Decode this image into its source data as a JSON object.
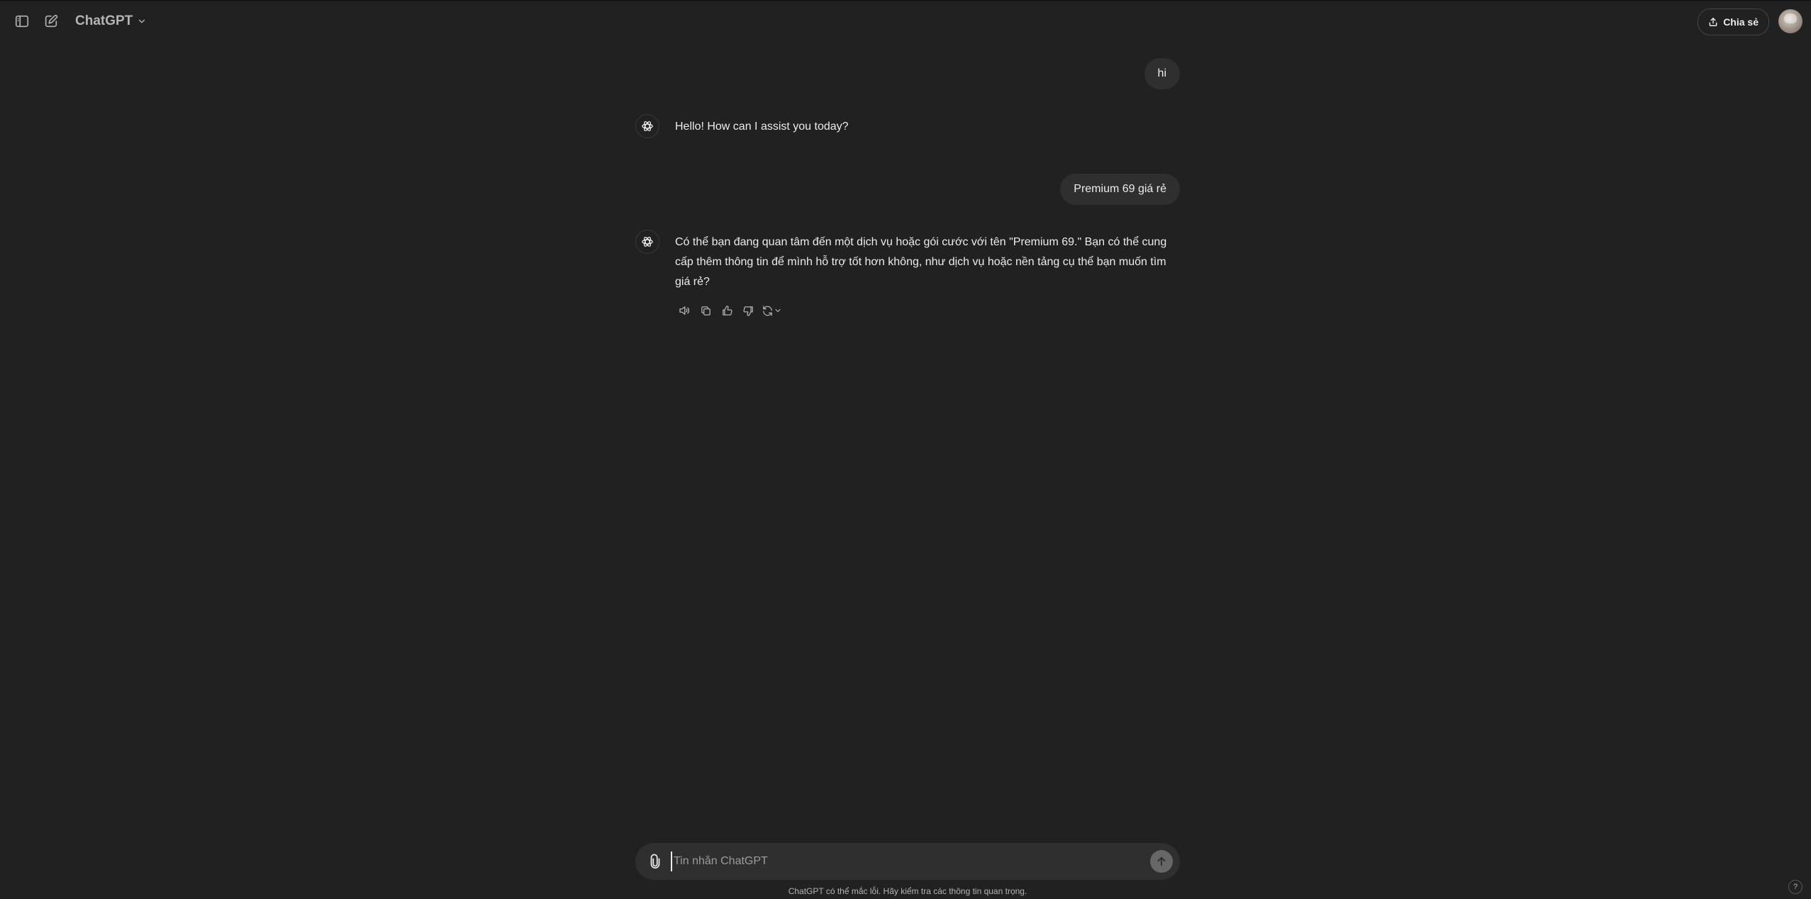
{
  "header": {
    "model_name": "ChatGPT",
    "share_label": "Chia sẻ"
  },
  "messages": [
    {
      "role": "user",
      "text": "hi"
    },
    {
      "role": "assistant",
      "text": "Hello! How can I assist you today?"
    },
    {
      "role": "user",
      "text": "Premium 69 giá rẻ"
    },
    {
      "role": "assistant",
      "text": "Có thể bạn đang quan tâm đến một dịch vụ hoặc gói cước với tên \"Premium 69.\" Bạn có thể cung cấp thêm thông tin để mình hỗ trợ tốt hơn không, như dịch vụ hoặc nền tảng cụ thể bạn muốn tìm giá rẻ?"
    }
  ],
  "composer": {
    "placeholder": "Tin nhắn ChatGPT",
    "value": ""
  },
  "footer": {
    "disclaimer": "ChatGPT có thể mắc lỗi. Hãy kiểm tra các thông tin quan trọng.",
    "help_label": "?"
  },
  "icons": {
    "sidebar": "sidebar-toggle-icon",
    "new_chat": "new-chat-icon",
    "model_chevron": "chevron-down-icon",
    "share": "share-upload-icon",
    "assistant": "openai-logo-icon",
    "read_aloud": "speaker-icon",
    "copy": "copy-icon",
    "thumbs_up": "thumbs-up-icon",
    "thumbs_down": "thumbs-down-icon",
    "regenerate": "regenerate-icon",
    "attach": "paperclip-icon",
    "send": "arrow-up-icon"
  }
}
